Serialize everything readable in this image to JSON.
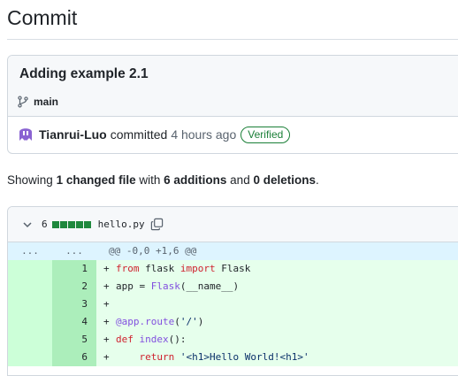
{
  "page": {
    "title": "Commit"
  },
  "commit": {
    "message": "Adding example 2.1",
    "branch": "main",
    "author": "Tianrui-Luo",
    "verb": "committed",
    "time": "4 hours ago",
    "badge": "Verified"
  },
  "summary": {
    "prefix": "Showing",
    "changed": "1 changed file",
    "with": "with",
    "additions": "6 additions",
    "and": "and",
    "deletions": "0 deletions",
    "end": "."
  },
  "file": {
    "changes": "6",
    "name": "hello.py",
    "diffstat_additions": 5,
    "hunk": {
      "old": "...",
      "new": "...",
      "header": "@@ -0,0 +1,6 @@"
    },
    "lines": [
      {
        "num": "1",
        "marker": "+",
        "tokens": [
          {
            "t": "kw",
            "v": "from"
          },
          {
            "t": "",
            "v": " flask "
          },
          {
            "t": "kw",
            "v": "import"
          },
          {
            "t": "",
            "v": " Flask"
          }
        ]
      },
      {
        "num": "2",
        "marker": "+",
        "tokens": [
          {
            "t": "",
            "v": "app = "
          },
          {
            "t": "fn",
            "v": "Flask"
          },
          {
            "t": "",
            "v": "(__name__)"
          }
        ]
      },
      {
        "num": "3",
        "marker": "+",
        "tokens": []
      },
      {
        "num": "4",
        "marker": "+",
        "tokens": [
          {
            "t": "fn",
            "v": "@app.route"
          },
          {
            "t": "",
            "v": "("
          },
          {
            "t": "str",
            "v": "'/'"
          },
          {
            "t": "",
            "v": ")"
          }
        ]
      },
      {
        "num": "5",
        "marker": "+",
        "tokens": [
          {
            "t": "kw",
            "v": "def"
          },
          {
            "t": "",
            "v": " "
          },
          {
            "t": "fn",
            "v": "index"
          },
          {
            "t": "",
            "v": "():"
          }
        ]
      },
      {
        "num": "6",
        "marker": "+",
        "tokens": [
          {
            "t": "",
            "v": "    "
          },
          {
            "t": "kw",
            "v": "return"
          },
          {
            "t": "",
            "v": " "
          },
          {
            "t": "str",
            "v": "'<h1>Hello World!<h1>'"
          }
        ]
      }
    ]
  },
  "colors": {
    "accent_green": "#1a7f37",
    "diff_add_bg": "#e6ffec",
    "hunk_bg": "#ddf4ff"
  }
}
